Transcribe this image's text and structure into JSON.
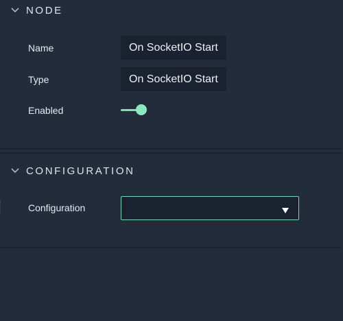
{
  "node_section": {
    "title": "NODE",
    "chevron_icon": "chevron-down-icon",
    "fields": {
      "name_label": "Name",
      "name_value": "On SocketIO Start",
      "type_label": "Type",
      "type_value": "On SocketIO Start",
      "enabled_label": "Enabled",
      "enabled_state": true
    }
  },
  "configuration_section": {
    "title": "CONFIGURATION",
    "chevron_icon": "chevron-down-icon",
    "fields": {
      "configuration_label": "Configuration",
      "configuration_value": "",
      "dropdown_icon": "caret-down-icon"
    }
  },
  "colors": {
    "background": "#222c3b",
    "field_background": "#1a2230",
    "accent": "#8ee8bf",
    "text": "#e6eaf0"
  }
}
